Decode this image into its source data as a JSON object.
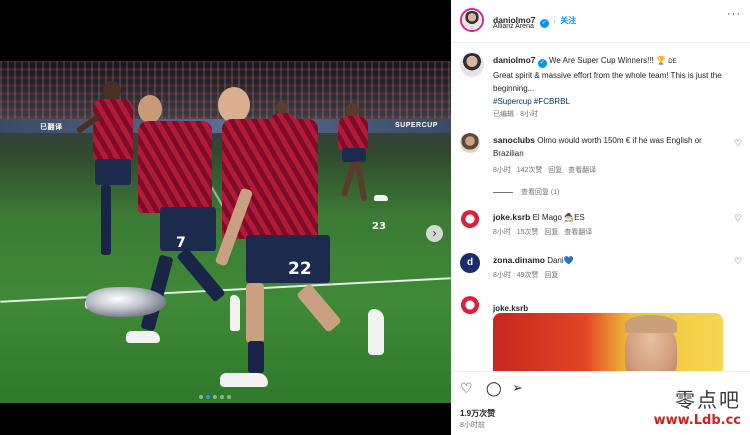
{
  "post": {
    "username": "daniolmo7",
    "location": "Allianz Arena",
    "follow_label": "关注",
    "more_icon": "more-horizontal-icon",
    "image": {
      "adboard_texts": [
        "已翻译",
        "SUPERCUP"
      ],
      "jersey_numbers": [
        "7",
        "22",
        "23"
      ],
      "carousel_dots": 5,
      "carousel_active_index": 1
    }
  },
  "caption": {
    "username": "daniolmo7",
    "text_line1": "We Are Super Cup Winners!!! 🏆",
    "flag": "DE",
    "text_line2": "Great spirit & massive effort from the whole team! This is just the beginning...",
    "hashtags": "#Supercup #FCBRBL",
    "edited": "已编辑",
    "time": "8小时"
  },
  "comments": [
    {
      "username": "sanoclubs",
      "text": "Olmo would worth 150m € if he was English or Brazilian",
      "time": "8小时",
      "likes": "142次赞",
      "reply": "回复",
      "translate": "查看翻译",
      "view_replies": "查看回复 (1)"
    },
    {
      "username": "joke.ksrb",
      "text": "El Mago 🧙‍♂️ES",
      "time": "8小时",
      "likes": "15次赞",
      "reply": "回复",
      "translate": "查看翻译"
    },
    {
      "username": "zona.dinamo",
      "text": "Dani💙",
      "time": "8小时",
      "likes": "49次赞",
      "reply": "回复"
    },
    {
      "username": "joke.ksrb",
      "text": ""
    }
  ],
  "stats": {
    "likes": "1.9万次赞",
    "time": "8小时前"
  },
  "watermark": {
    "cn": "零点吧",
    "url": "www.Ldb.cc"
  },
  "colors": {
    "accent": "#0095f6",
    "hashtag": "#00376b",
    "meta": "#737373",
    "watermark_red": "#d11f1f"
  }
}
